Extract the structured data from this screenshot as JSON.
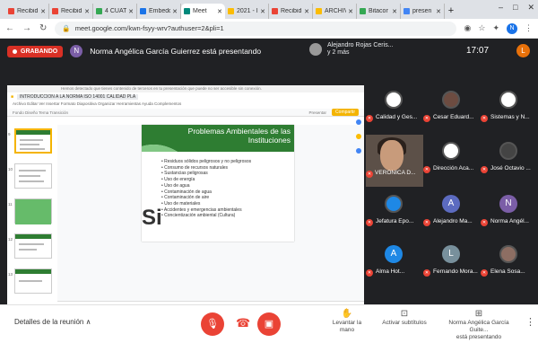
{
  "browser": {
    "tabs": [
      {
        "label": "Recibid",
        "color": "#ea4335"
      },
      {
        "label": "Recibid",
        "color": "#ea4335"
      },
      {
        "label": "4 CUAT",
        "color": "#34a853"
      },
      {
        "label": "Embedd",
        "color": "#1a73e8"
      },
      {
        "label": "Meet",
        "color": "#00897b",
        "active": true
      },
      {
        "label": "2021 - I",
        "color": "#fbbc04"
      },
      {
        "label": "Recibid",
        "color": "#ea4335"
      },
      {
        "label": "ARCHIV",
        "color": "#fbbc04"
      },
      {
        "label": "Bitacor",
        "color": "#34a853"
      },
      {
        "label": "presen",
        "color": "#4285f4"
      }
    ],
    "url": "meet.google.com/kwn-fsyy-wrv?authuser=2&pli=1",
    "profile_initial": "N"
  },
  "meet": {
    "recording_label": "GRABANDO",
    "presenter_initial": "N",
    "presenting_text": "Norma Angélica García Guierrez está presentando",
    "pinned_name": "Alejandro Rojas Ceris...",
    "pinned_extra": "y 2 más",
    "clock": "17:07",
    "self_initial": "L"
  },
  "slides": {
    "doc_title": "INTRODUCCION A LA NORMA ISO 14001 CALIDAD PLA",
    "top_notice": "Hemos detectado que tienes contenido de terceros en tu presentación que puede no ser accesible sin conexión.",
    "menu": "Archivo  Editar  Ver  Insertar  Formato  Diapositiva  Organizar  Herramientas  Ayuda  Complementos",
    "toolbar": "Fondo   Diseño   Tema   Transición",
    "present_label": "Presentar",
    "share_label": "Compartir",
    "slide_title_line1": "Problemas Ambientales de las",
    "slide_title_line2": "Instituciones",
    "bullets": [
      "Residuos sólidos peligrosos y no peligrosos",
      "Consumo de recursos naturales",
      "Sustancias peligrosas",
      "Uso de energía",
      "Uso de agua",
      "Contaminación de agua",
      "Contaminación de aire",
      "Uso de materiales",
      "Accidentes y emergencias ambientales",
      "Concientización ambiental (Cultura)"
    ],
    "slide_big_letter": "Si",
    "notes_placeholder": "Haz clic para añadir notas del orador"
  },
  "participants": [
    {
      "name": "Calidad y Ges...",
      "initial": "",
      "color": "#ffffff"
    },
    {
      "name": "Cesar Eduard...",
      "initial": "",
      "color": "#6d4c41"
    },
    {
      "name": "Sistemas y N...",
      "initial": "",
      "color": "#ffffff"
    },
    {
      "name": "Dirección Aca...",
      "initial": "",
      "color": "#ffffff"
    },
    {
      "name": "José Octavio ...",
      "initial": "",
      "color": "#444444"
    },
    {
      "name": "Jefatura Epo...",
      "initial": "",
      "color": "#1e88e5"
    },
    {
      "name": "Alejandro Ma...",
      "initial": "A",
      "color": "#5c6bc0"
    },
    {
      "name": "Norma Angél...",
      "initial": "N",
      "color": "#7b5ea7"
    },
    {
      "name": "Alma Hot...",
      "initial": "A",
      "color": "#1e88e5"
    },
    {
      "name": "Fernando Mora...",
      "initial": "L",
      "color": "#78909c"
    },
    {
      "name": "Elena Sosa...",
      "initial": "",
      "color": "#8d6e63"
    }
  ],
  "video_participant": {
    "name": "VERONICA D..."
  },
  "bottom": {
    "details_label": "Detalles de la reunión",
    "raise_hand_label": "Levantar la mano",
    "captions_label": "Activar subtítulos",
    "presenting_line1": "Norma Angélica García Guite...",
    "presenting_line2": "está presentando"
  }
}
